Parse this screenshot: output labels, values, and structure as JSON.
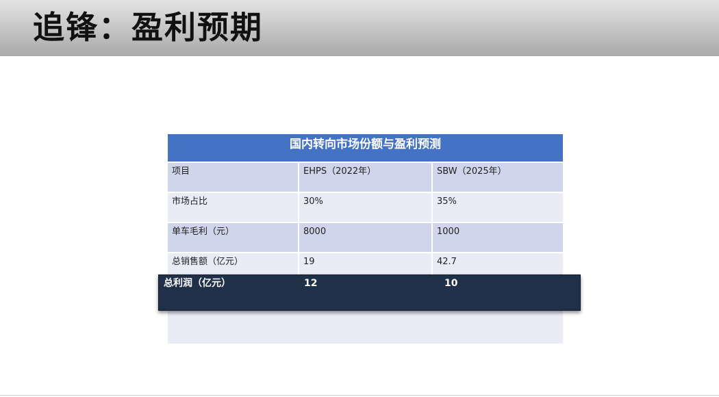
{
  "slide": {
    "title": "追锋：盈利预期"
  },
  "table": {
    "header": "国内转向市场份额与盈利预测",
    "rows": [
      [
        "项目",
        "EHPS（2022年）",
        "SBW（2025年）"
      ],
      [
        "市场占比",
        "30%",
        "35%"
      ],
      [
        "单车毛利（元）",
        "8000",
        "1000"
      ],
      [
        "总销售额（亿元）",
        "19",
        "42.7"
      ]
    ],
    "highlight_row": [
      "总利润（亿元）",
      "12",
      "10"
    ]
  },
  "colors": {
    "header_bg": "#4472c4",
    "row_dark": "#cfd5ea",
    "row_light": "#e9ebf5",
    "highlight_bg": "#203049",
    "title_bar": "#b5b5b5"
  }
}
